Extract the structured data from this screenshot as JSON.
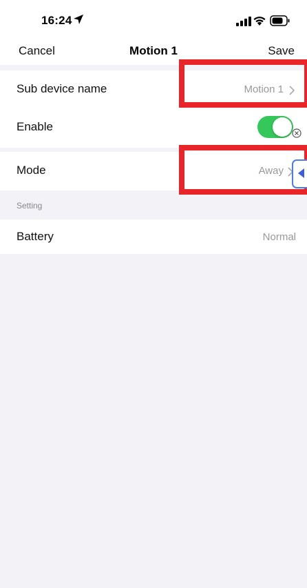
{
  "status_bar": {
    "time": "16:24",
    "location_icon": "location-arrow-icon",
    "signal_icon": "cellular-signal-icon",
    "wifi_icon": "wifi-icon",
    "battery_icon": "battery-icon"
  },
  "nav": {
    "cancel_label": "Cancel",
    "title": "Motion 1",
    "save_label": "Save"
  },
  "rows": {
    "sub_device_name": {
      "label": "Sub device name",
      "value": "Motion 1"
    },
    "enable": {
      "label": "Enable",
      "enabled": true
    },
    "mode": {
      "label": "Mode",
      "value": "Away"
    },
    "setting_header": "Setting",
    "battery": {
      "label": "Battery",
      "value": "Normal"
    }
  },
  "colors": {
    "toggle_on": "#34c759",
    "highlight": "#e8262a",
    "floating_button_border": "#4b7bf0",
    "background": "#f3f3f7",
    "value_text": "#999999"
  },
  "overlays": {
    "close_icon": "close-circle-icon",
    "floating_icon": "play-triangle-icon"
  }
}
